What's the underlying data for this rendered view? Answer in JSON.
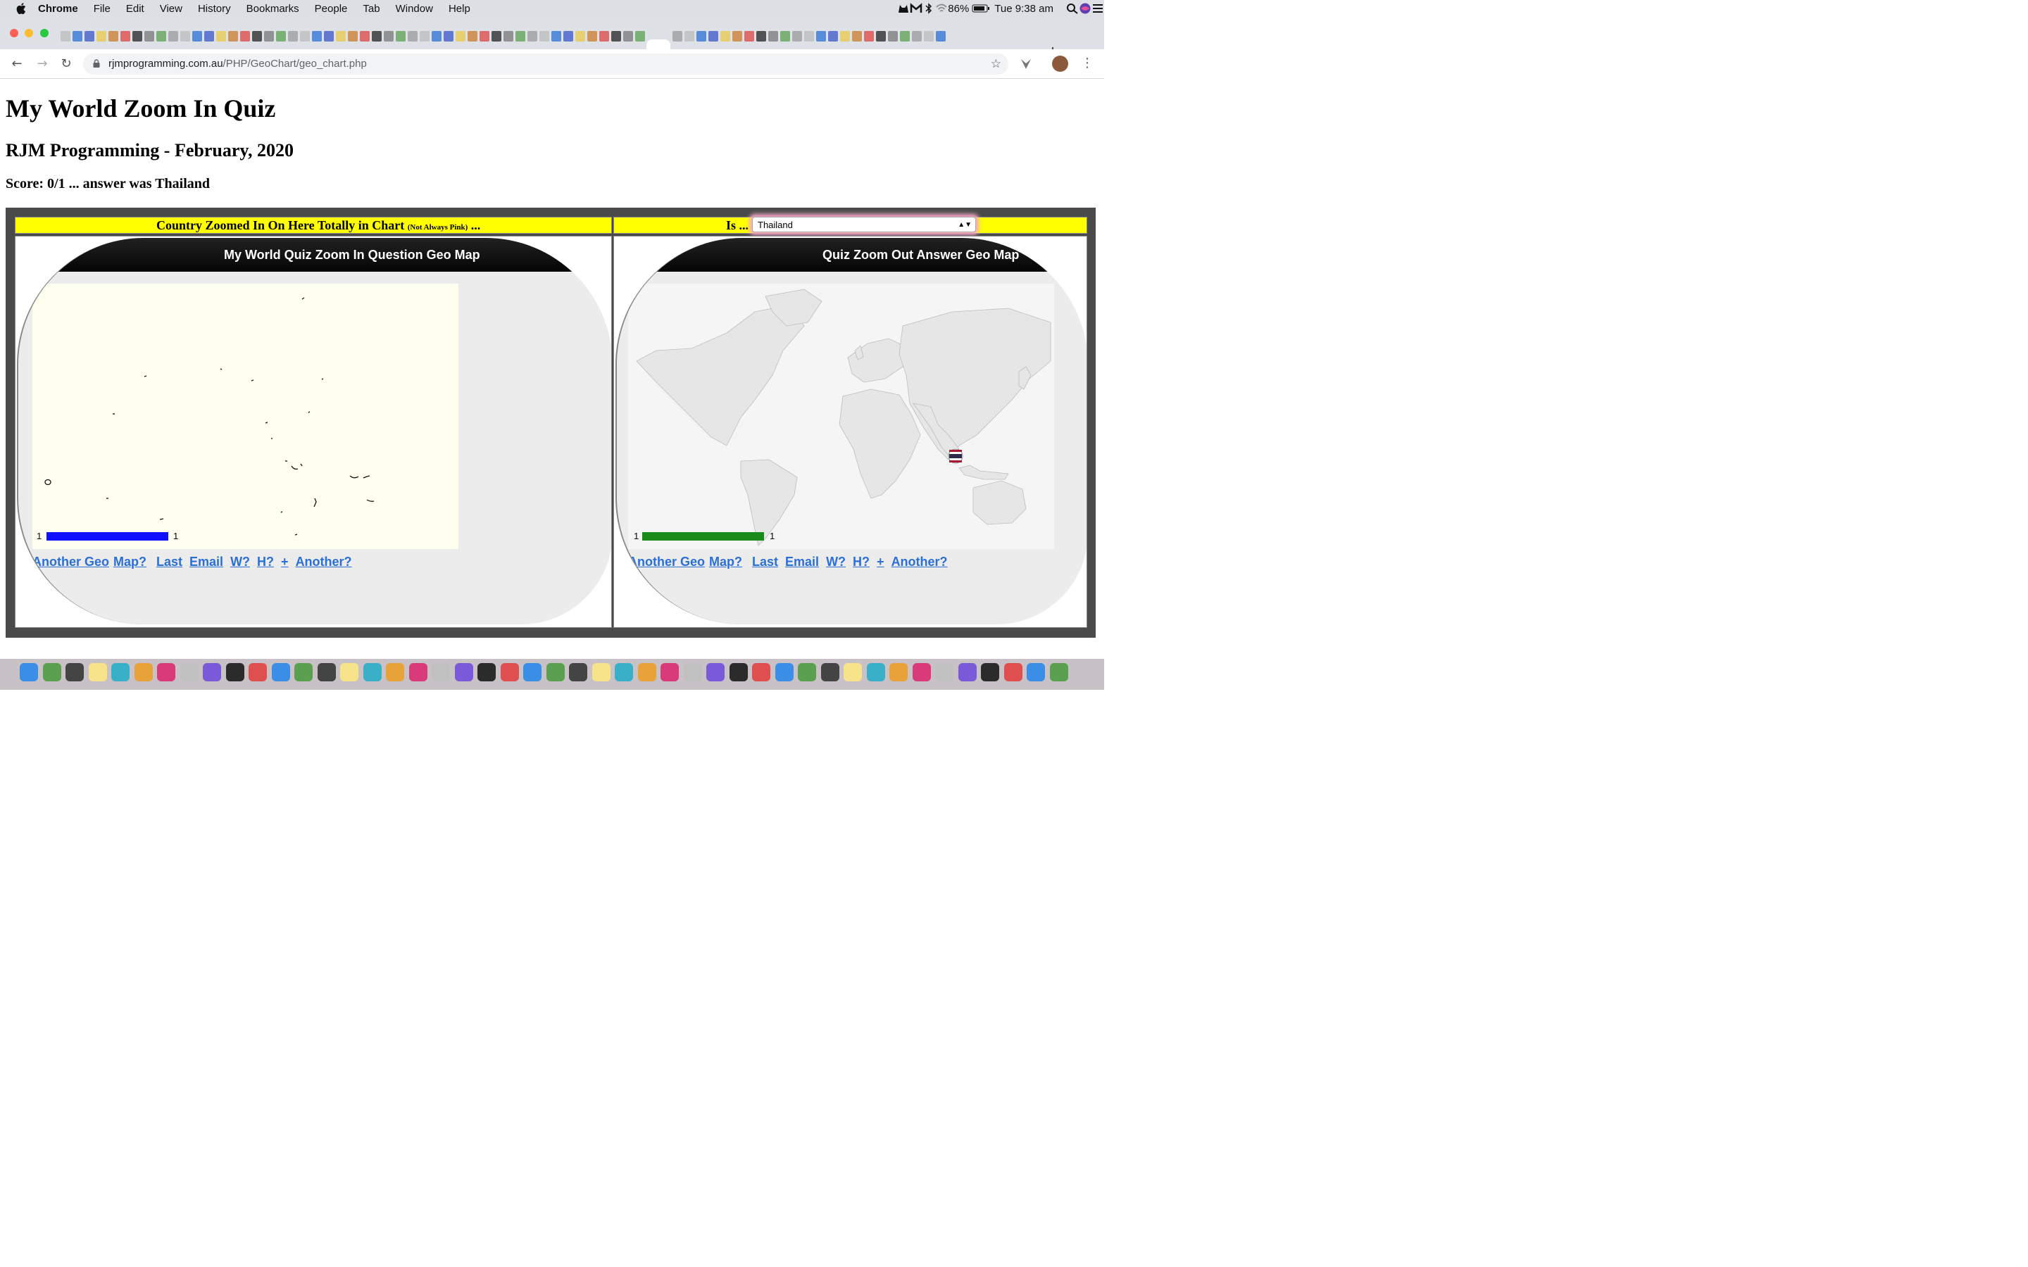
{
  "menubar": {
    "app_name": "Chrome",
    "items": [
      "File",
      "Edit",
      "View",
      "History",
      "Bookmarks",
      "People",
      "Tab",
      "Window",
      "Help"
    ],
    "battery": "86%",
    "clock": "Tue 9:38 am"
  },
  "browser": {
    "close_tab": "×",
    "new_tab": "+",
    "url_host": "rjmprogramming.com.au",
    "url_path": "/PHP/GeoChart/geo_chart.php",
    "back": "←",
    "forward": "→",
    "reload": "↻",
    "star": "☆",
    "menu": "⋮"
  },
  "page": {
    "title": "My World Zoom In Quiz",
    "subtitle": "RJM Programming - February, 2020",
    "score": "Score: 0/1 ... answer was Thailand"
  },
  "quiz": {
    "left_header": "Country Zoomed In On Here Totally in Chart",
    "left_header_small": "(Not Always Pink)",
    "left_header_tail": "...",
    "right_header": "Is ...",
    "selected_country": "Thailand",
    "select_arrow": "▲▼",
    "left_panel": {
      "heading": "My World Quiz Zoom In Question Geo Map",
      "legend_min": "1",
      "legend_max": "1",
      "legend_color": "#1010ff",
      "map_background": "#fffff0",
      "links": [
        "Another Geo",
        "Map?",
        "Last",
        "Email",
        "W?",
        "H?",
        "+",
        "Another?"
      ]
    },
    "right_panel": {
      "heading": "Quiz Zoom Out Answer Geo Map",
      "legend_min": "1",
      "legend_max": "1",
      "legend_color": "#1a8a1a",
      "map_background": "#f5f5f5",
      "links": [
        "Another Geo",
        "Map?",
        "Last",
        "Email",
        "W?",
        "H?",
        "+",
        "Another?"
      ]
    }
  },
  "colors": {
    "header_yellow": "#ffff00",
    "select_glow": "#f7a8c8",
    "link_blue": "#2a6fd6"
  }
}
